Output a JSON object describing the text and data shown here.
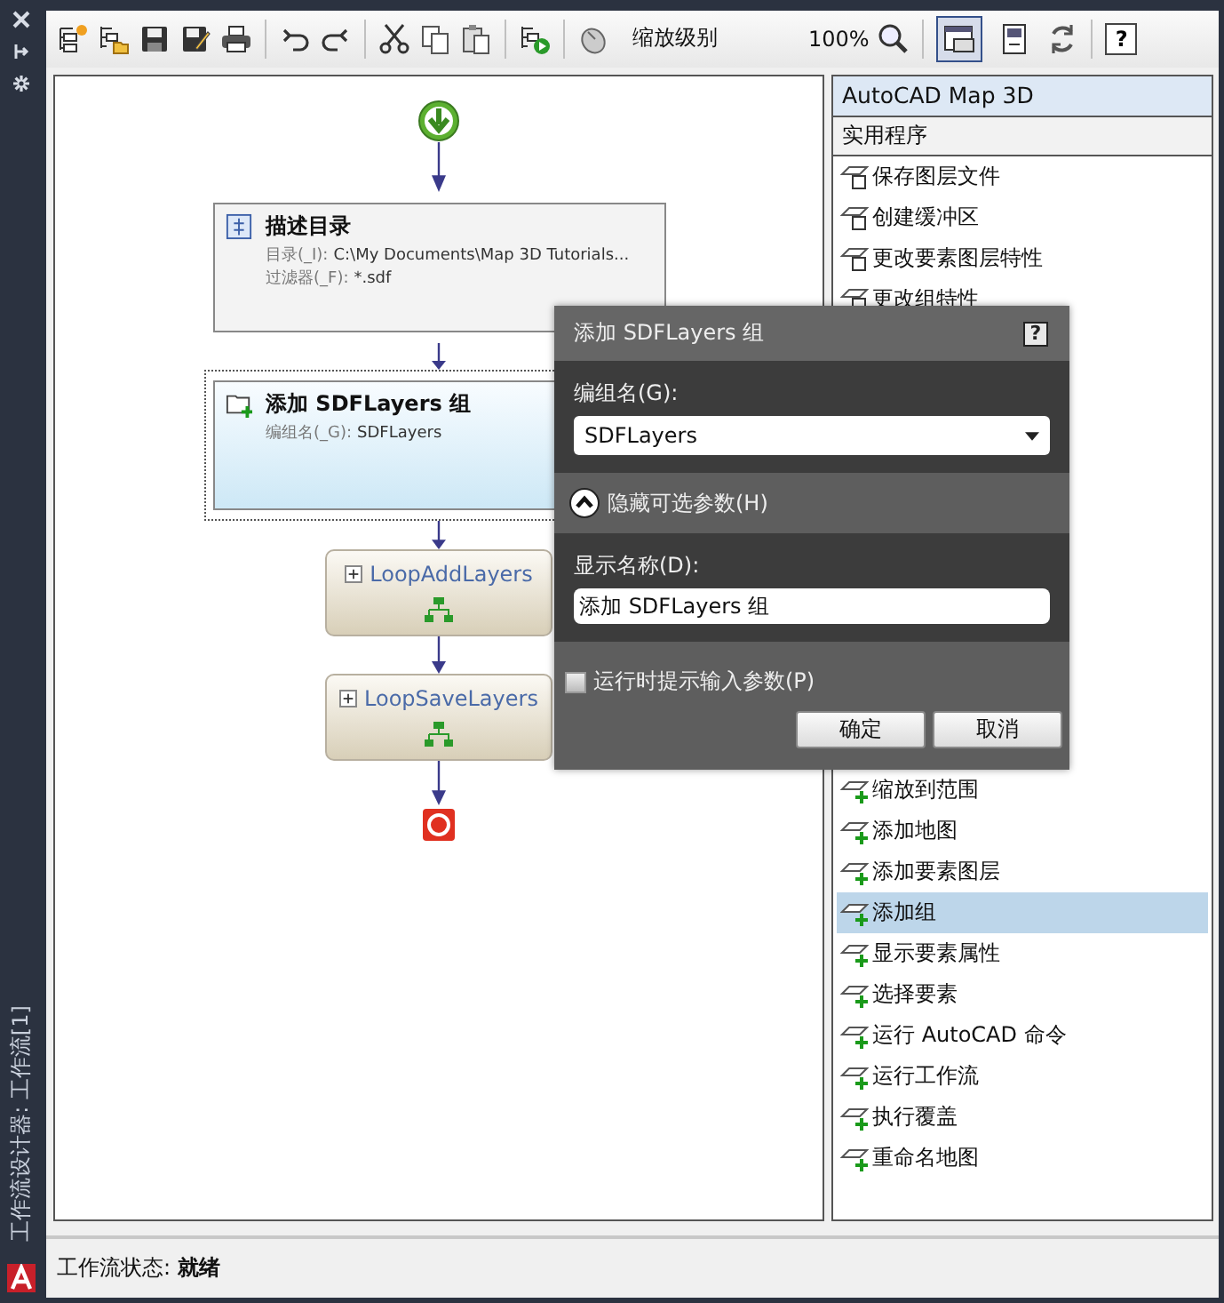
{
  "side_title": "工作流设计器: 工作流[1]",
  "toolbar": {
    "zoom_label": "缩放级别",
    "zoom_value": "100%",
    "view_buttons": [
      {
        "selected": true
      },
      {
        "selected": false
      }
    ],
    "help": "?"
  },
  "canvas": {
    "nodes": [
      {
        "kind": "start"
      },
      {
        "kind": "activity",
        "title": "描述目录",
        "selected": false,
        "params": [
          {
            "label": "目录(_I):",
            "value": "C:\\My Documents\\Map 3D Tutorials..."
          },
          {
            "label": "过滤器(_F):",
            "value": "*.sdf"
          }
        ]
      },
      {
        "kind": "activity",
        "title": "添加 SDFLayers 组",
        "selected": true,
        "params": [
          {
            "label": "编组名(_G):",
            "value": "SDFLayers"
          }
        ]
      },
      {
        "kind": "loop",
        "title": "LoopAddLayers",
        "expanded": false
      },
      {
        "kind": "loop",
        "title": "LoopSaveLayers",
        "expanded": false
      },
      {
        "kind": "end"
      }
    ]
  },
  "library": {
    "title": "AutoCAD Map 3D",
    "category": "实用程序",
    "items_top": [
      {
        "label": "保存图层文件",
        "selected": false
      },
      {
        "label": "创建缓冲区",
        "selected": false
      },
      {
        "label": "更改要素图层特性",
        "selected": false
      },
      {
        "label": "更改组特性",
        "selected": false
      }
    ],
    "items_bottom": [
      {
        "label": "缩放到范围",
        "selected": false
      },
      {
        "label": "添加地图",
        "selected": false
      },
      {
        "label": "添加要素图层",
        "selected": false
      },
      {
        "label": "添加组",
        "selected": true
      },
      {
        "label": "显示要素属性",
        "selected": false
      },
      {
        "label": "选择要素",
        "selected": false
      },
      {
        "label": "运行 AutoCAD 命令",
        "selected": false
      },
      {
        "label": "运行工作流",
        "selected": false
      },
      {
        "label": "执行覆盖",
        "selected": false
      },
      {
        "label": "重命名地图",
        "selected": false
      }
    ]
  },
  "dialog": {
    "title": "添加 SDFLayers 组",
    "help": "?",
    "group_label": "编组名(G):",
    "group_value": "SDFLayers",
    "optional_toggle": {
      "label": "隐藏可选参数(H)",
      "expanded": true
    },
    "display_label": "显示名称(D):",
    "display_value": "添加 SDFLayers 组",
    "prompt": {
      "label": "运行时提示输入参数(P)",
      "checked": false
    },
    "buttons": [
      "确定",
      "取消"
    ]
  },
  "status": {
    "label": "工作流状态:",
    "value": "就绪"
  }
}
